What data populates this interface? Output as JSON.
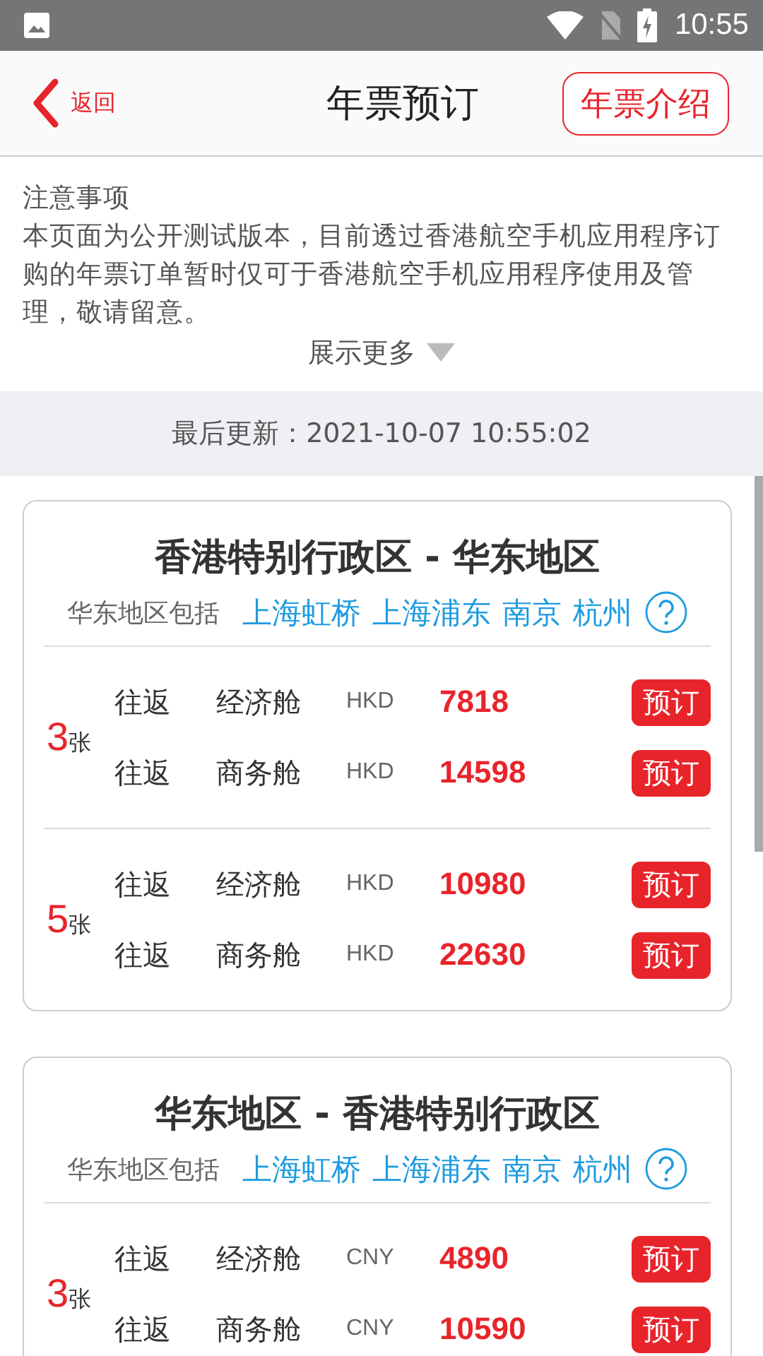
{
  "status_bar": {
    "time": "10:55"
  },
  "header": {
    "back": "返回",
    "title": "年票预订",
    "intro_button": "年票介绍"
  },
  "notice": {
    "title": "注意事项",
    "body": "本页面为公开测试版本，目前透过香港航空手机应用程序订购的年票订单暂时仅可于香港航空手机应用程序使用及管理，敬请留意。",
    "more": "展示更多"
  },
  "last_updated": "最后更新：2021-10-07 10:55:02",
  "cards": [
    {
      "title": "香港特别行政区 - 华东地区",
      "includes_label": "华东地区包括",
      "cities": [
        "上海虹桥",
        "上海浦东",
        "南京",
        "杭州"
      ],
      "groups": [
        {
          "count": "3",
          "unit": "张",
          "rows": [
            {
              "trip": "往返",
              "cabin": "经济舱",
              "currency": "HKD",
              "price": "7818",
              "button": "预订"
            },
            {
              "trip": "往返",
              "cabin": "商务舱",
              "currency": "HKD",
              "price": "14598",
              "button": "预订"
            }
          ]
        },
        {
          "count": "5",
          "unit": "张",
          "rows": [
            {
              "trip": "往返",
              "cabin": "经济舱",
              "currency": "HKD",
              "price": "10980",
              "button": "预订"
            },
            {
              "trip": "往返",
              "cabin": "商务舱",
              "currency": "HKD",
              "price": "22630",
              "button": "预订"
            }
          ]
        }
      ]
    },
    {
      "title": "华东地区 - 香港特别行政区",
      "includes_label": "华东地区包括",
      "cities": [
        "上海虹桥",
        "上海浦东",
        "南京",
        "杭州"
      ],
      "groups": [
        {
          "count": "3",
          "unit": "张",
          "rows": [
            {
              "trip": "往返",
              "cabin": "经济舱",
              "currency": "CNY",
              "price": "4890",
              "button": "预订"
            },
            {
              "trip": "往返",
              "cabin": "商务舱",
              "currency": "CNY",
              "price": "10590",
              "button": "预订"
            }
          ]
        }
      ]
    }
  ]
}
